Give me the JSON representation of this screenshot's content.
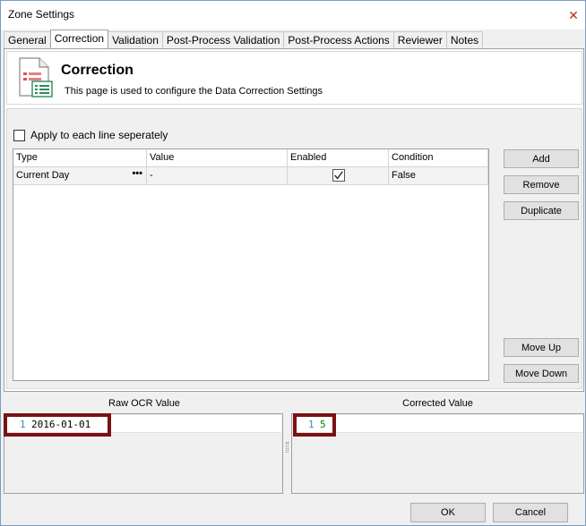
{
  "window": {
    "title": "Zone Settings",
    "close_glyph": "✕"
  },
  "tabs": [
    {
      "label": "General"
    },
    {
      "label": "Correction"
    },
    {
      "label": "Validation"
    },
    {
      "label": "Post-Process Validation"
    },
    {
      "label": "Post-Process Actions"
    },
    {
      "label": "Reviewer"
    },
    {
      "label": "Notes"
    }
  ],
  "active_tab": "Correction",
  "header": {
    "title": "Correction",
    "description": "This page is used to configure the Data Correction Settings",
    "icon": "document-settings-icon"
  },
  "apply_each_line": {
    "label": "Apply to each line seperately",
    "checked": false
  },
  "grid": {
    "columns": [
      "Type",
      "Value",
      "Enabled",
      "Condition"
    ],
    "rows": [
      {
        "type": "Current Day",
        "value": "-",
        "enabled": true,
        "condition": "False"
      }
    ],
    "ellipsis_glyph": "•••"
  },
  "side_buttons": {
    "add": "Add",
    "remove": "Remove",
    "duplicate": "Duplicate",
    "move_up": "Move Up",
    "move_down": "Move Down"
  },
  "raw_ocr": {
    "label": "Raw OCR Value",
    "line_no": "1",
    "text": "2016-01-01"
  },
  "corrected": {
    "label": "Corrected Value",
    "line_no": "1",
    "text": "5"
  },
  "footer": {
    "ok": "OK",
    "cancel": "Cancel"
  },
  "colors": {
    "highlight": "#7b1113",
    "accent_border": "#7a9cc4",
    "corrected_text": "#008000"
  }
}
